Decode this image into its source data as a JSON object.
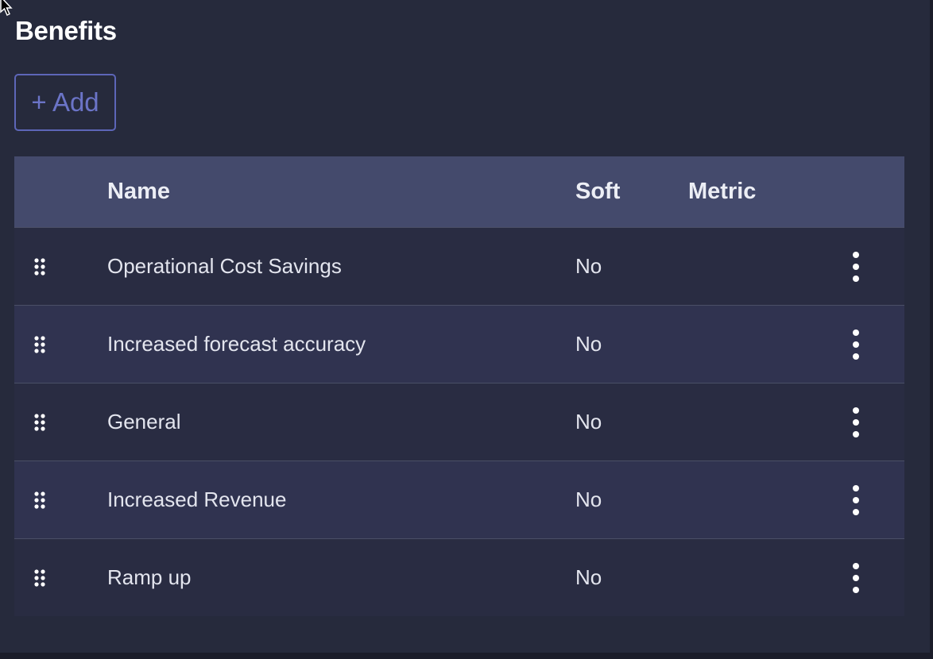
{
  "page": {
    "title": "Benefits",
    "add_button_label": "+ Add"
  },
  "icons": {
    "drag": "drag-handle-icon",
    "menu": "more-vertical-icon",
    "cursor": "mouse-pointer-icon"
  },
  "colors": {
    "background": "#262a3c",
    "header": "#444a6c",
    "row": "#303350",
    "row_alt": "#292c42",
    "accent": "#5d66b8",
    "text": "#e3e5ee"
  },
  "table": {
    "columns": [
      "Name",
      "Soft",
      "Metric"
    ],
    "rows": [
      {
        "name": "Operational Cost Savings",
        "soft": "No",
        "metric": ""
      },
      {
        "name": "Increased forecast accuracy",
        "soft": "No",
        "metric": ""
      },
      {
        "name": "General",
        "soft": "No",
        "metric": ""
      },
      {
        "name": "Increased Revenue",
        "soft": "No",
        "metric": ""
      },
      {
        "name": "Ramp up",
        "soft": "No",
        "metric": ""
      }
    ]
  }
}
